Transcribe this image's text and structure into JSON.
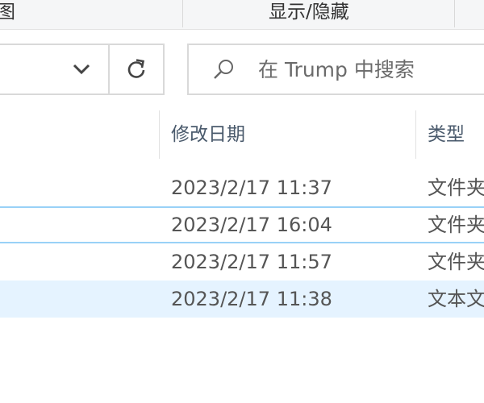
{
  "ribbon": {
    "left_label": "图",
    "view_label": "显示/隐藏"
  },
  "address": {
    "dropdown_icon": "chevron-down-icon",
    "refresh_icon": "refresh-icon"
  },
  "search": {
    "placeholder": "在 Trump 中搜索",
    "icon": "search-icon"
  },
  "columns": {
    "modified": "修改日期",
    "type": "类型"
  },
  "rows": [
    {
      "modified": "2023/2/17 11:37",
      "type": "文件夹",
      "state": "normal"
    },
    {
      "modified": "2023/2/17 16:04",
      "type": "文件夹",
      "state": "hovered"
    },
    {
      "modified": "2023/2/17 11:57",
      "type": "文件夹",
      "state": "normal"
    },
    {
      "modified": "2023/2/17 11:38",
      "type": "文本文档",
      "state": "selected"
    }
  ],
  "colors": {
    "selected_bg": "#e5f3ff",
    "hover_border": "#99d1f7",
    "header_text": "#4a5a6c"
  }
}
